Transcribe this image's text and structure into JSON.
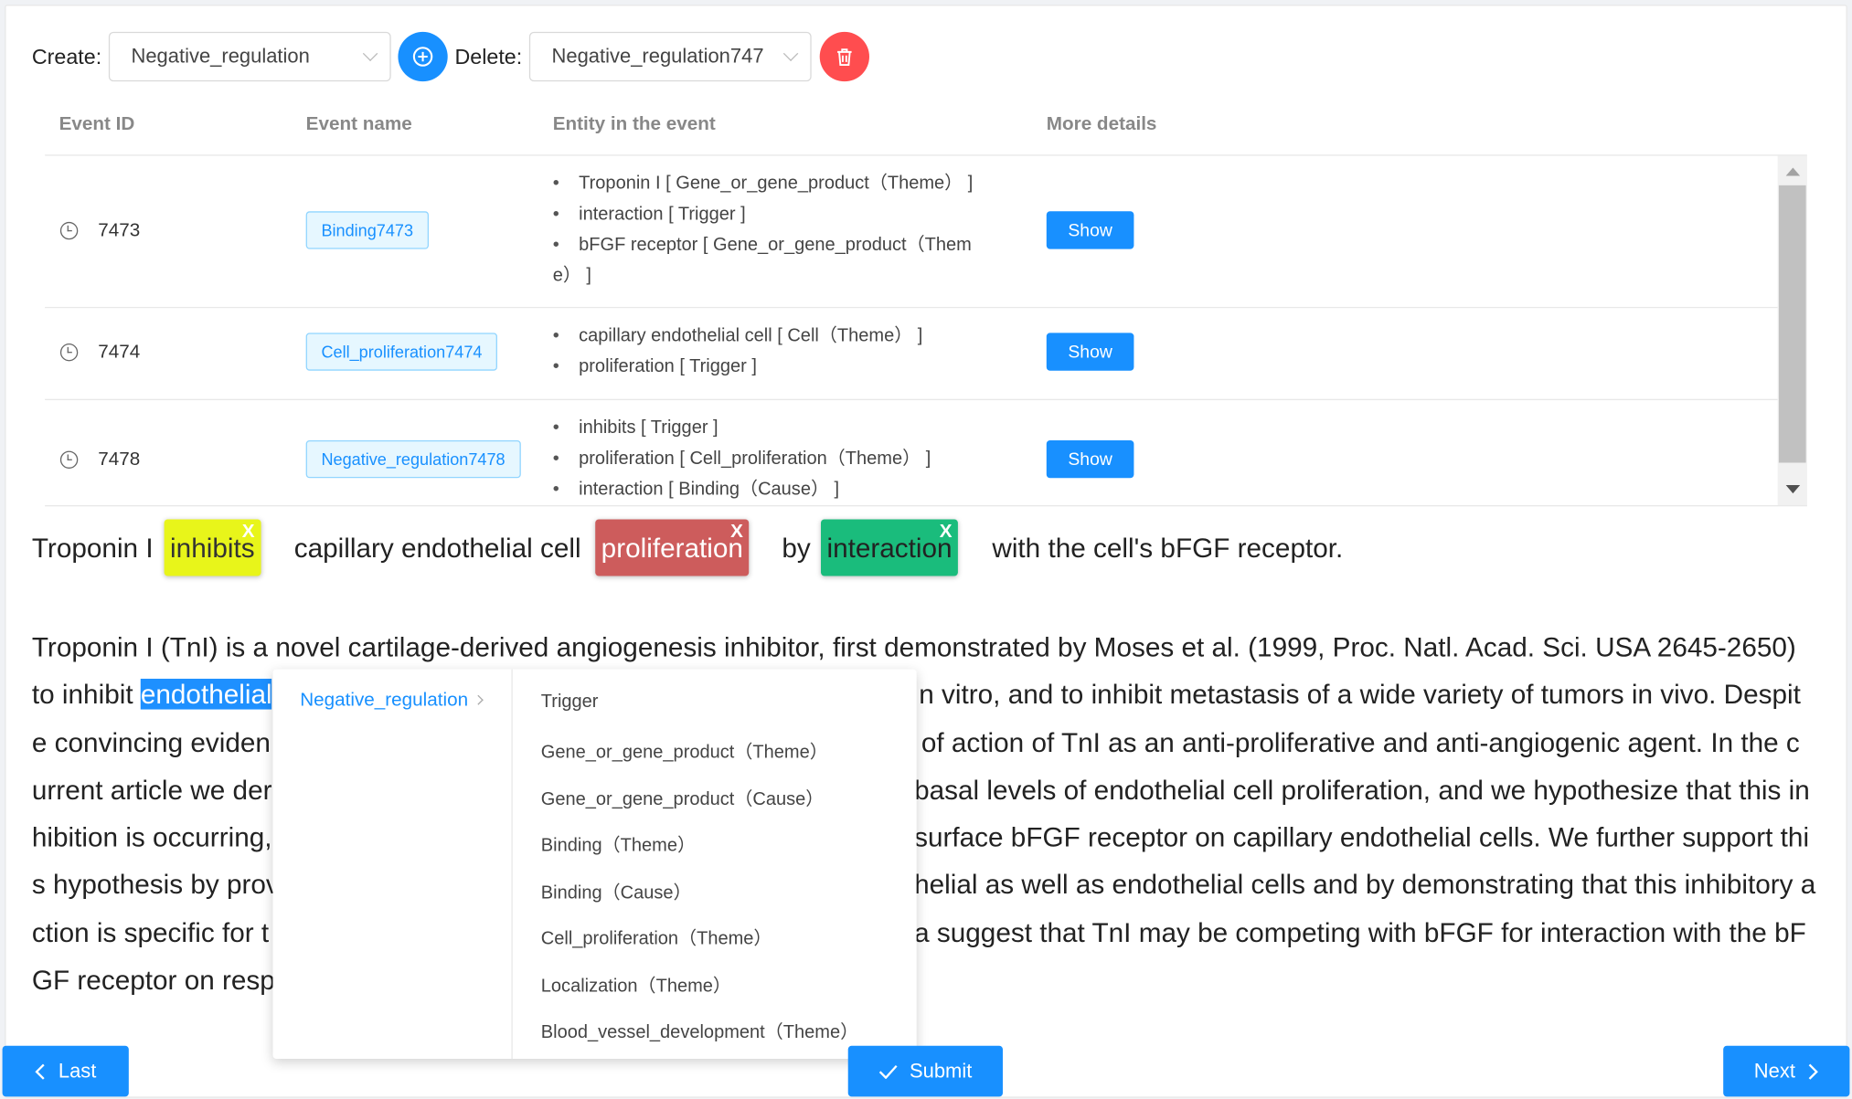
{
  "toolbar": {
    "create_label": "Create:",
    "create_value": "Negative_regulation",
    "delete_label": "Delete:",
    "delete_value": "Negative_regulation747"
  },
  "table": {
    "headers": [
      "Event ID",
      "Event name",
      "Entity in the event",
      "More details"
    ],
    "rows": [
      {
        "id": "7473",
        "name": "Binding7473",
        "entities": [
          "Troponin I [ Gene_or_gene_product（Theme） ]",
          "interaction [ Trigger ]",
          "bFGF receptor [ Gene_or_gene_product（Them",
          "e） ]"
        ],
        "action": "Show"
      },
      {
        "id": "7474",
        "name": "Cell_proliferation7474",
        "entities": [
          "capillary endothelial cell [ Cell（Theme） ]",
          "proliferation [ Trigger ]"
        ],
        "action": "Show"
      },
      {
        "id": "7478",
        "name": "Negative_regulation7478",
        "entities": [
          "inhibits [ Trigger ]",
          "proliferation [ Cell_proliferation（Theme） ]",
          "interaction [ Binding（Cause） ]"
        ],
        "action": "Show"
      }
    ]
  },
  "sentence": {
    "t1": "Troponin I",
    "h1": "inhibits",
    "t2": "capillary endothelial cell",
    "h2": "proliferation",
    "t3": "by",
    "h3": "interaction",
    "t4": "with the cell's bFGF receptor.",
    "close": "x",
    "colors": {
      "inhibits": "#e8f51a",
      "proliferation": "#cd5c5c",
      "interaction": "#1abc7c"
    }
  },
  "paragraph": {
    "l1": "Troponin I (TnI) is a novel cartilage-derived angiogenesis inhibitor, first demonstrated by Moses et al. (1999, Proc. Natl. Acad. Sci. USA 2645-2650)",
    "l2_a": "to inhibit ",
    "l2_sel": "endothelial",
    "l2_b": "n vitro, and to inhibit metastasis of a wide variety of tumors in vivo. Despit",
    "l3_a": "e convincing eviden",
    "l3_b": "of action of TnI as an anti-proliferative and anti-angiogenic agent. In the c",
    "l4_a": "urrent article we der",
    "l4_b": "basal levels of endothelial cell proliferation, and we hypothesize that this in",
    "l5_a": "hibition is occurring,",
    "l5_b": "surface bFGF receptor on capillary endothelial cells. We further support thi",
    "l6_a": "s hypothesis by prov",
    "l6_b": "helial as well as endothelial cells and by demonstrating that this inhibitory a",
    "l7_a": "ction is specific for t",
    "l7_b": "a suggest that TnI may be competing with bFGF for interaction with the bF",
    "l8_a": "GF receptor on resp"
  },
  "dropdown": {
    "category": "Negative_regulation",
    "options": [
      "Trigger",
      "Gene_or_gene_product（Theme）",
      "Gene_or_gene_product（Cause）",
      "Binding（Theme）",
      "Binding（Cause）",
      "Cell_proliferation（Theme）",
      "Localization（Theme）",
      "Blood_vessel_development（Theme）"
    ]
  },
  "footer": {
    "last": "Last",
    "submit": "Submit",
    "next": "Next"
  },
  "colors": {
    "primary": "#1890ff",
    "danger": "#ff4d4f",
    "selection": "#1e90ff"
  }
}
